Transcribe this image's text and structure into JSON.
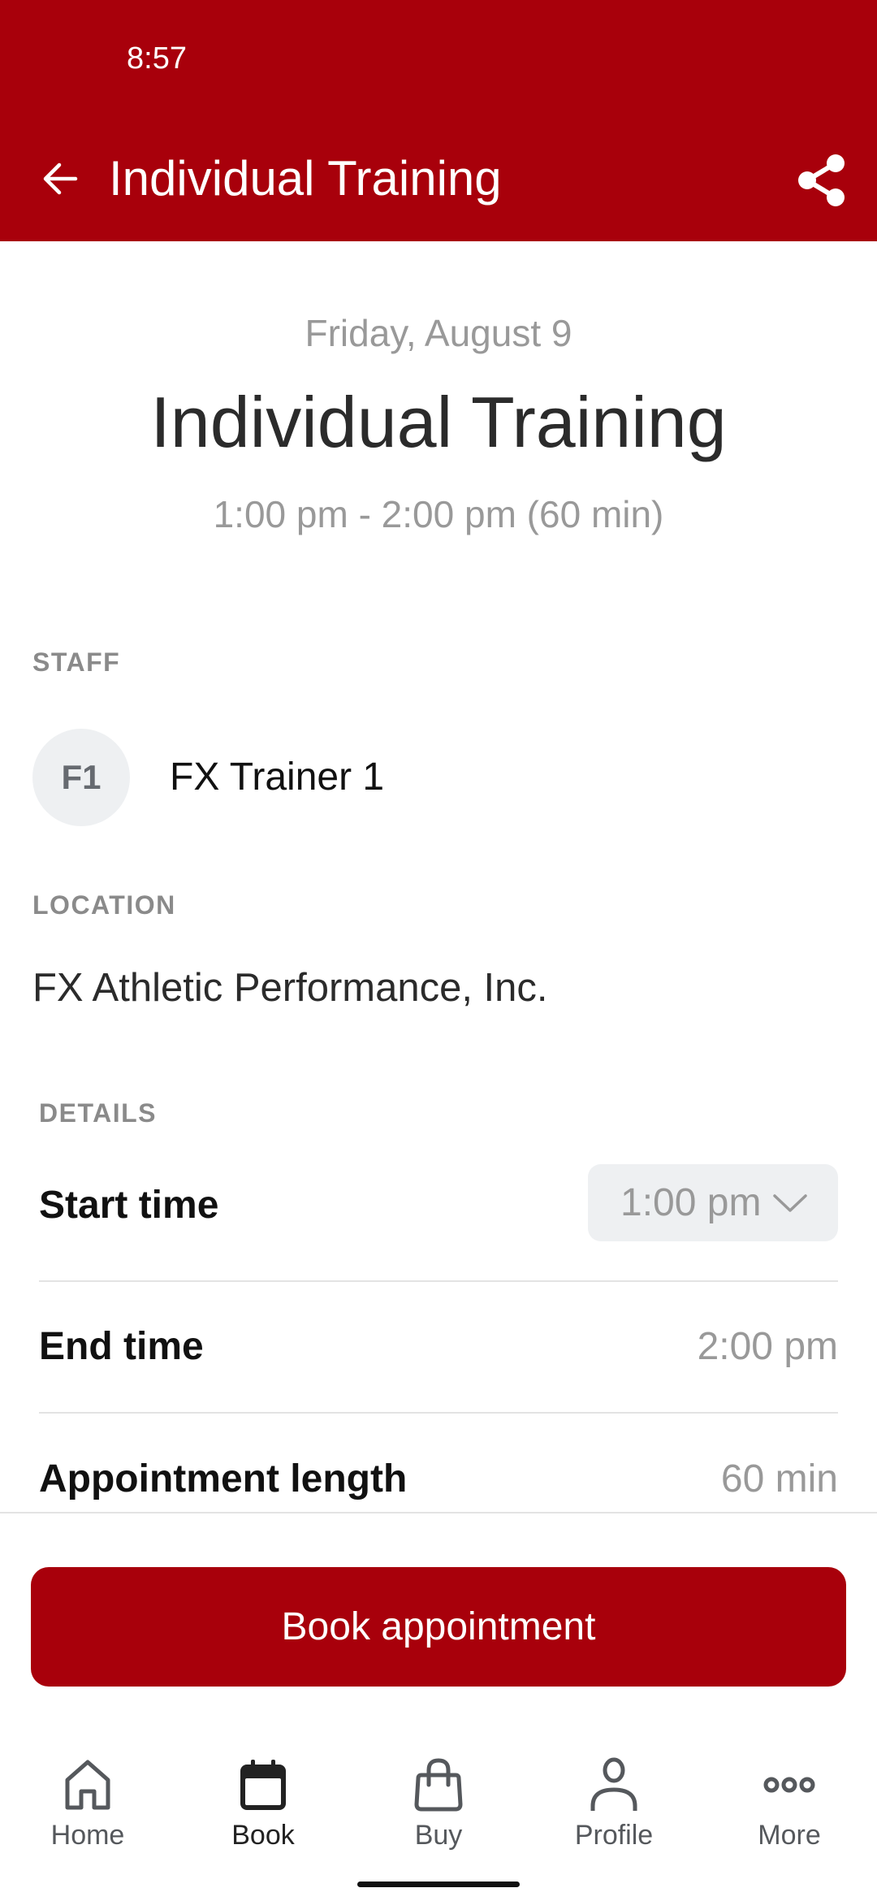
{
  "status_bar": {
    "time": "8:57"
  },
  "app_bar": {
    "title": "Individual Training",
    "back_icon": "arrow-left-icon",
    "share_icon": "share-icon",
    "background_color": "#A8000B"
  },
  "appointment": {
    "date": "Friday, August 9",
    "title": "Individual Training",
    "time_range": "1:00 pm - 2:00 pm (60 min)"
  },
  "staff": {
    "section_label": "STAFF",
    "avatar_initials": "F1",
    "name": "FX Trainer 1"
  },
  "location": {
    "section_label": "LOCATION",
    "name": "FX Athletic Performance, Inc."
  },
  "details": {
    "section_label": "DETAILS",
    "rows": [
      {
        "label": "Start time",
        "value": "1:00 pm",
        "type": "dropdown"
      },
      {
        "label": "End time",
        "value": "2:00 pm"
      },
      {
        "label": "Appointment length",
        "value": "60 min"
      }
    ]
  },
  "actions": {
    "book_label": "Book appointment",
    "book_color": "#A8000B"
  },
  "bottom_nav": {
    "active": "Book",
    "items": [
      {
        "label": "Home",
        "icon": "home-icon"
      },
      {
        "label": "Book",
        "icon": "calendar-icon"
      },
      {
        "label": "Buy",
        "icon": "shopping-bag-icon"
      },
      {
        "label": "Profile",
        "icon": "person-icon"
      },
      {
        "label": "More",
        "icon": "more-horizontal-icon"
      }
    ]
  }
}
